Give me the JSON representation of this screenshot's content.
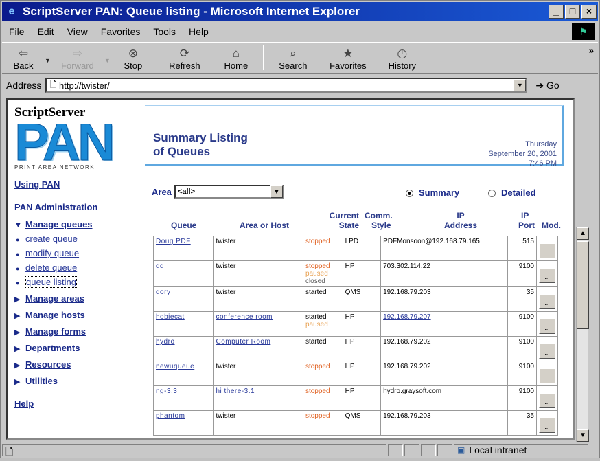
{
  "window": {
    "title": "ScriptServer PAN: Queue listing - Microsoft Internet Explorer",
    "min_label": "_",
    "max_label": "□",
    "close_label": "×"
  },
  "menu": [
    "File",
    "Edit",
    "View",
    "Favorites",
    "Tools",
    "Help"
  ],
  "toolbar": {
    "back": "Back",
    "forward": "Forward",
    "stop": "Stop",
    "refresh": "Refresh",
    "home": "Home",
    "search": "Search",
    "favorites": "Favorites",
    "history": "History"
  },
  "address": {
    "label": "Address",
    "url": "http://twister/",
    "go": "Go"
  },
  "logo": {
    "top": "ScriptServer",
    "main": "PAN",
    "sub": "PRINT AREA NETWORK"
  },
  "header": {
    "title_line1": "Summary Listing",
    "title_line2": "of Queues",
    "day": "Thursday",
    "date": "September 20, 2001",
    "time": "7:46 PM"
  },
  "nav": {
    "using_pan": "Using PAN",
    "admin_heading": "PAN Administration",
    "manage_queues": "Manage queues",
    "sub_items": [
      "create queue",
      "modify queue",
      "delete queue",
      "queue listing"
    ],
    "sections": [
      "Manage areas",
      "Manage hosts",
      "Manage forms",
      "Departments",
      "Resources",
      "Utilities"
    ],
    "help": "Help"
  },
  "filter": {
    "area_label": "Area",
    "area_value": "<all>",
    "summary_label": "Summary",
    "detailed_label": "Detailed"
  },
  "columns": {
    "queue": "Queue",
    "area": "Area or Host",
    "state_1": "Current",
    "state_2": "State",
    "comm_1": "Comm.",
    "comm_2": "Style",
    "ip_1": "IP",
    "ip_2": "Address",
    "port_1": "IP",
    "port_2": "Port",
    "mod": "Mod."
  },
  "rows": [
    {
      "queue": "Doug PDF",
      "area": "twister",
      "states": [
        "stopped"
      ],
      "style": "LPD",
      "ip": "PDFMonsoon@192.168.79.165",
      "port": "515"
    },
    {
      "queue": "dd",
      "area": "twister",
      "states": [
        "stopped",
        "paused",
        "closed"
      ],
      "style": "HP",
      "ip": "703.302.114.22",
      "port": "9100"
    },
    {
      "queue": "dory",
      "area": "twister",
      "states": [
        "started"
      ],
      "style": "QMS",
      "ip": "192.168.79.203",
      "port": "35"
    },
    {
      "queue": "hobiecat",
      "area": "conference room",
      "states": [
        "started",
        "paused"
      ],
      "style": "HP",
      "ip": "192.168.79.207",
      "port": "9100"
    },
    {
      "queue": "hydro",
      "area": "Computer Room",
      "states": [
        "started"
      ],
      "style": "HP",
      "ip": "192.168.79.202",
      "port": "9100"
    },
    {
      "queue": "newuqueue",
      "area": "twister",
      "states": [
        "stopped"
      ],
      "style": "HP",
      "ip": "192.168.79.202",
      "port": "9100"
    },
    {
      "queue": "ng-3.3",
      "area": "hi there-3.1",
      "states": [
        "stopped"
      ],
      "style": "HP",
      "ip": "hydro.graysoft.com",
      "port": "9100"
    },
    {
      "queue": "phantom",
      "area": "twister",
      "states": [
        "stopped"
      ],
      "style": "QMS",
      "ip": "192.168.79.203",
      "port": "35"
    }
  ],
  "mod_label": "...",
  "status": {
    "zone": "Local intranet"
  }
}
